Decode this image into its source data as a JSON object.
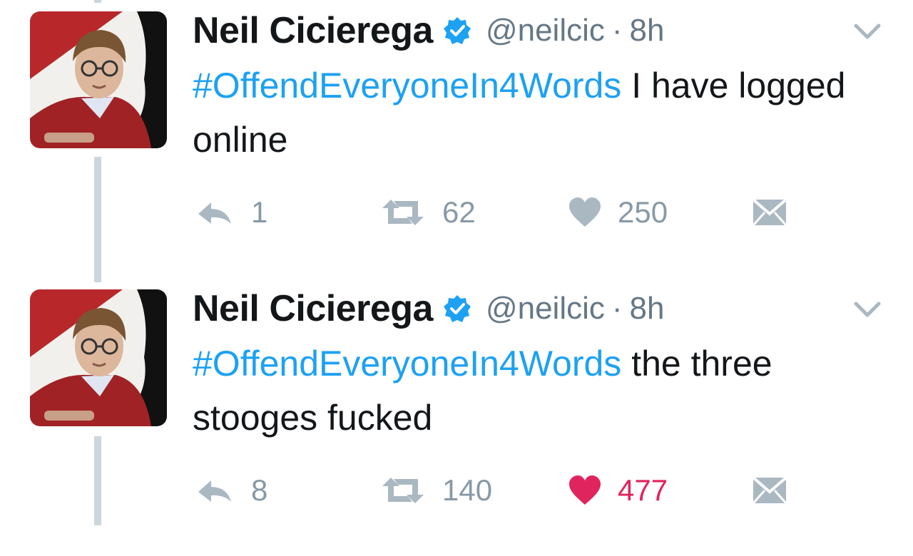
{
  "tweets": [
    {
      "author": {
        "name": "Neil Cicierega",
        "handle": "@neilcic",
        "verified": true
      },
      "time": "8h",
      "hashtag": "#OffendEveryoneIn4Words",
      "body": "I have logged online",
      "replies": "1",
      "retweets": "62",
      "likes": "250",
      "liked": false
    },
    {
      "author": {
        "name": "Neil Cicierega",
        "handle": "@neilcic",
        "verified": true
      },
      "time": "8h",
      "hashtag": "#OffendEveryoneIn4Words",
      "body": "the three stooges fucked",
      "replies": "8",
      "retweets": "140",
      "likes": "477",
      "liked": true
    }
  ],
  "separator": "·",
  "icons": {
    "reply": "reply-icon",
    "retweet": "retweet-icon",
    "like": "heart-icon",
    "dm": "envelope-icon",
    "caret": "chevron-down-icon",
    "verified": "verified-badge-icon"
  },
  "colors": {
    "accent": "#1da1f2",
    "like_active": "#e0245e",
    "muted": "#8899a6",
    "thread_line": "#ccd6dd",
    "text": "#14171a"
  }
}
